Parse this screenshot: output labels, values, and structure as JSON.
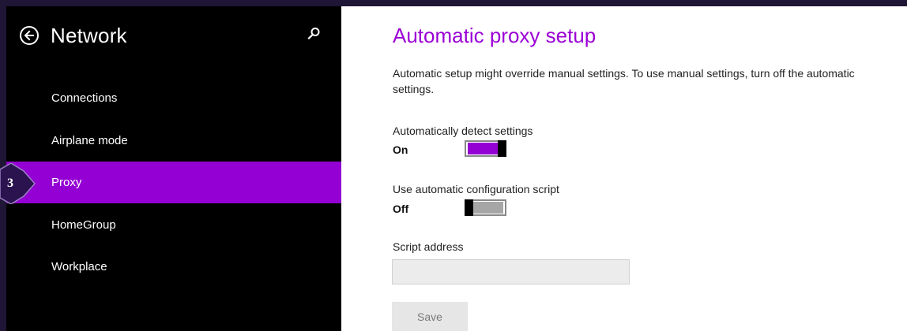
{
  "sidebar": {
    "title": "Network",
    "items": [
      {
        "label": "Connections"
      },
      {
        "label": "Airplane mode"
      },
      {
        "label": "Proxy"
      },
      {
        "label": "HomeGroup"
      },
      {
        "label": "Workplace"
      }
    ],
    "selected_item": "Proxy",
    "badge": "3"
  },
  "main": {
    "title": "Automatic proxy setup",
    "description": "Automatic setup might override manual settings. To use manual settings, turn off the automatic settings.",
    "auto_detect": {
      "label": "Automatically detect settings",
      "state": "On"
    },
    "use_script": {
      "label": "Use automatic configuration script",
      "state": "Off"
    },
    "script_address": {
      "label": "Script address",
      "value": ""
    },
    "save_label": "Save"
  },
  "colors": {
    "accent": "#9400d3",
    "title": "#9b00d6",
    "sidebar_bg": "#000000",
    "frame": "#1f1534"
  },
  "icons": [
    "back-arrow-icon",
    "search-icon"
  ]
}
